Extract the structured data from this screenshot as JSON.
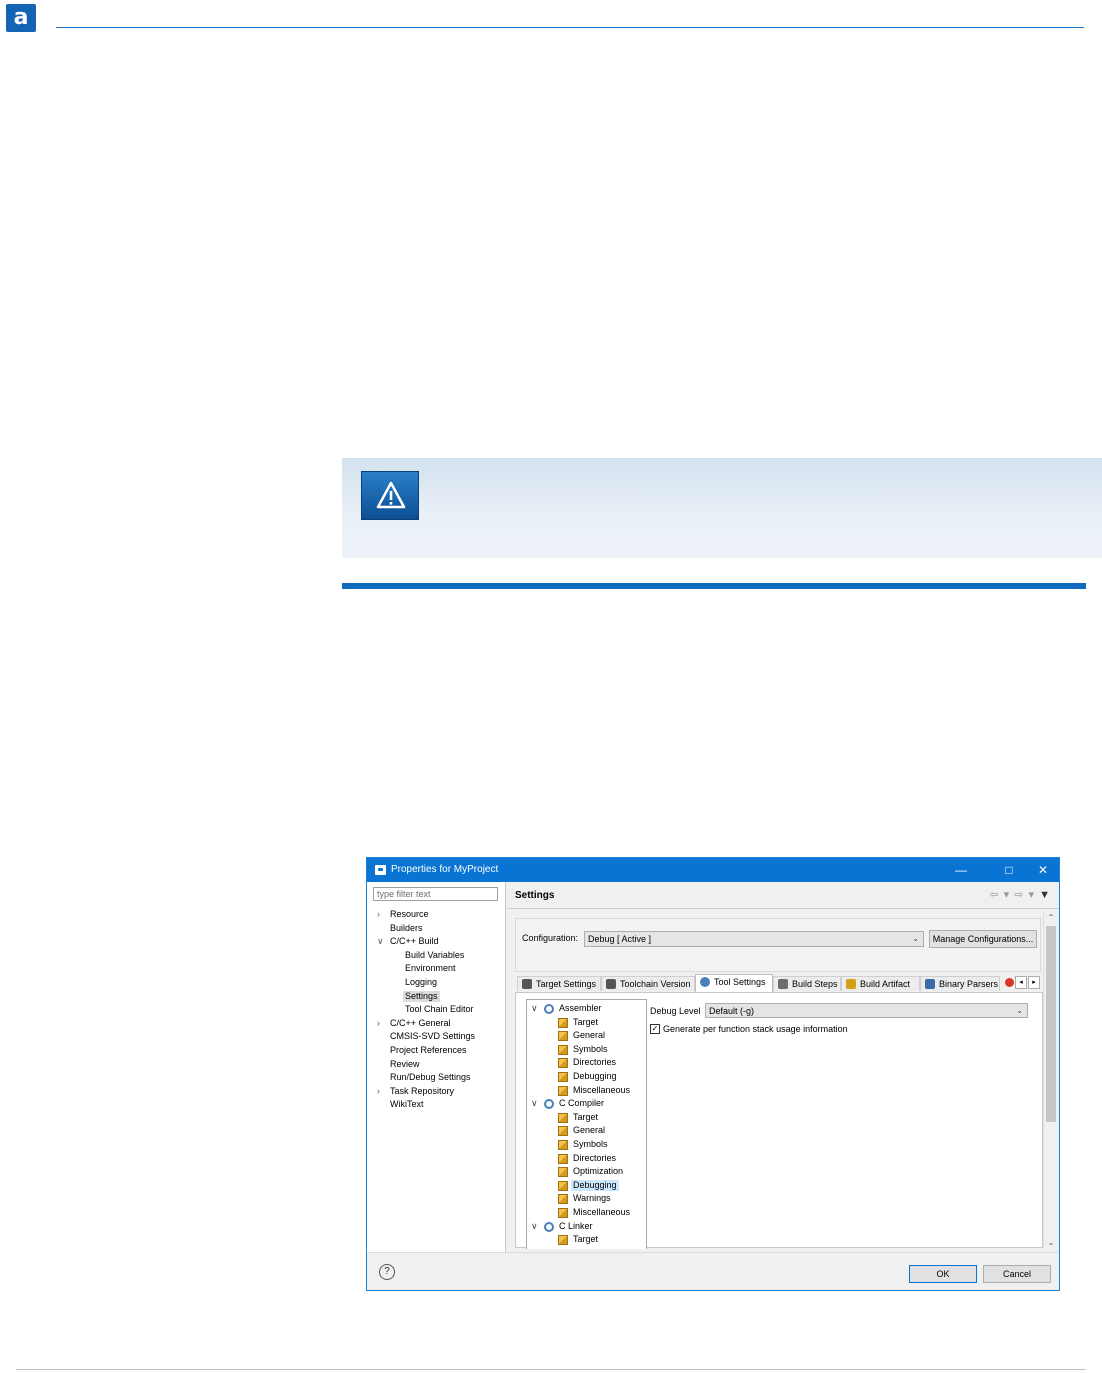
{
  "page": {
    "logo_letter": "a"
  },
  "dialog": {
    "title": "Properties for MyProject",
    "filter_placeholder": "type filter text",
    "nav_items": [
      {
        "label": "Resource",
        "expander": ">"
      },
      {
        "label": "Builders",
        "expander": ""
      },
      {
        "label": "C/C++ Build",
        "expander": "v"
      },
      {
        "label": "Build Variables",
        "expander": ""
      },
      {
        "label": "Environment",
        "expander": ""
      },
      {
        "label": "Logging",
        "expander": ""
      },
      {
        "label": "Settings",
        "expander": "",
        "selected": true
      },
      {
        "label": "Tool Chain Editor",
        "expander": ""
      },
      {
        "label": "C/C++ General",
        "expander": ">"
      },
      {
        "label": "CMSIS-SVD Settings",
        "expander": ""
      },
      {
        "label": "Project References",
        "expander": ""
      },
      {
        "label": "Review",
        "expander": ""
      },
      {
        "label": "Run/Debug Settings",
        "expander": ""
      },
      {
        "label": "Task Repository",
        "expander": ">"
      },
      {
        "label": "WikiText",
        "expander": ""
      }
    ],
    "section_title": "Settings",
    "configuration_label": "Configuration:",
    "configuration_value": "Debug  [ Active ]",
    "manage_button": "Manage Configurations...",
    "tabs": [
      {
        "label": "Target Settings",
        "icon": "target-icon"
      },
      {
        "label": "Toolchain Version",
        "icon": "toolchain-icon"
      },
      {
        "label": "Tool Settings",
        "icon": "gear-icon",
        "active": true
      },
      {
        "label": "Build Steps",
        "icon": "wrench-icon"
      },
      {
        "label": "Build Artifact",
        "icon": "trophy-icon"
      },
      {
        "label": "Binary Parsers",
        "icon": "binary-icon"
      }
    ],
    "tool_tree": [
      {
        "label": "Assembler",
        "type": "tool"
      },
      {
        "label": "Target",
        "type": "option"
      },
      {
        "label": "General",
        "type": "option"
      },
      {
        "label": "Symbols",
        "type": "option"
      },
      {
        "label": "Directories",
        "type": "option"
      },
      {
        "label": "Debugging",
        "type": "option"
      },
      {
        "label": "Miscellaneous",
        "type": "option"
      },
      {
        "label": "C Compiler",
        "type": "tool"
      },
      {
        "label": "Target",
        "type": "option"
      },
      {
        "label": "General",
        "type": "option"
      },
      {
        "label": "Symbols",
        "type": "option"
      },
      {
        "label": "Directories",
        "type": "option"
      },
      {
        "label": "Optimization",
        "type": "option"
      },
      {
        "label": "Debugging",
        "type": "option",
        "selected": true
      },
      {
        "label": "Warnings",
        "type": "option"
      },
      {
        "label": "Miscellaneous",
        "type": "option"
      },
      {
        "label": "C Linker",
        "type": "tool"
      },
      {
        "label": "Target",
        "type": "option"
      }
    ],
    "debug_level_label": "Debug Level",
    "debug_level_value": "Default (-g)",
    "stack_usage_label": "Generate per function stack usage information",
    "stack_usage_checked": true,
    "ok_button": "OK",
    "cancel_button": "Cancel"
  }
}
